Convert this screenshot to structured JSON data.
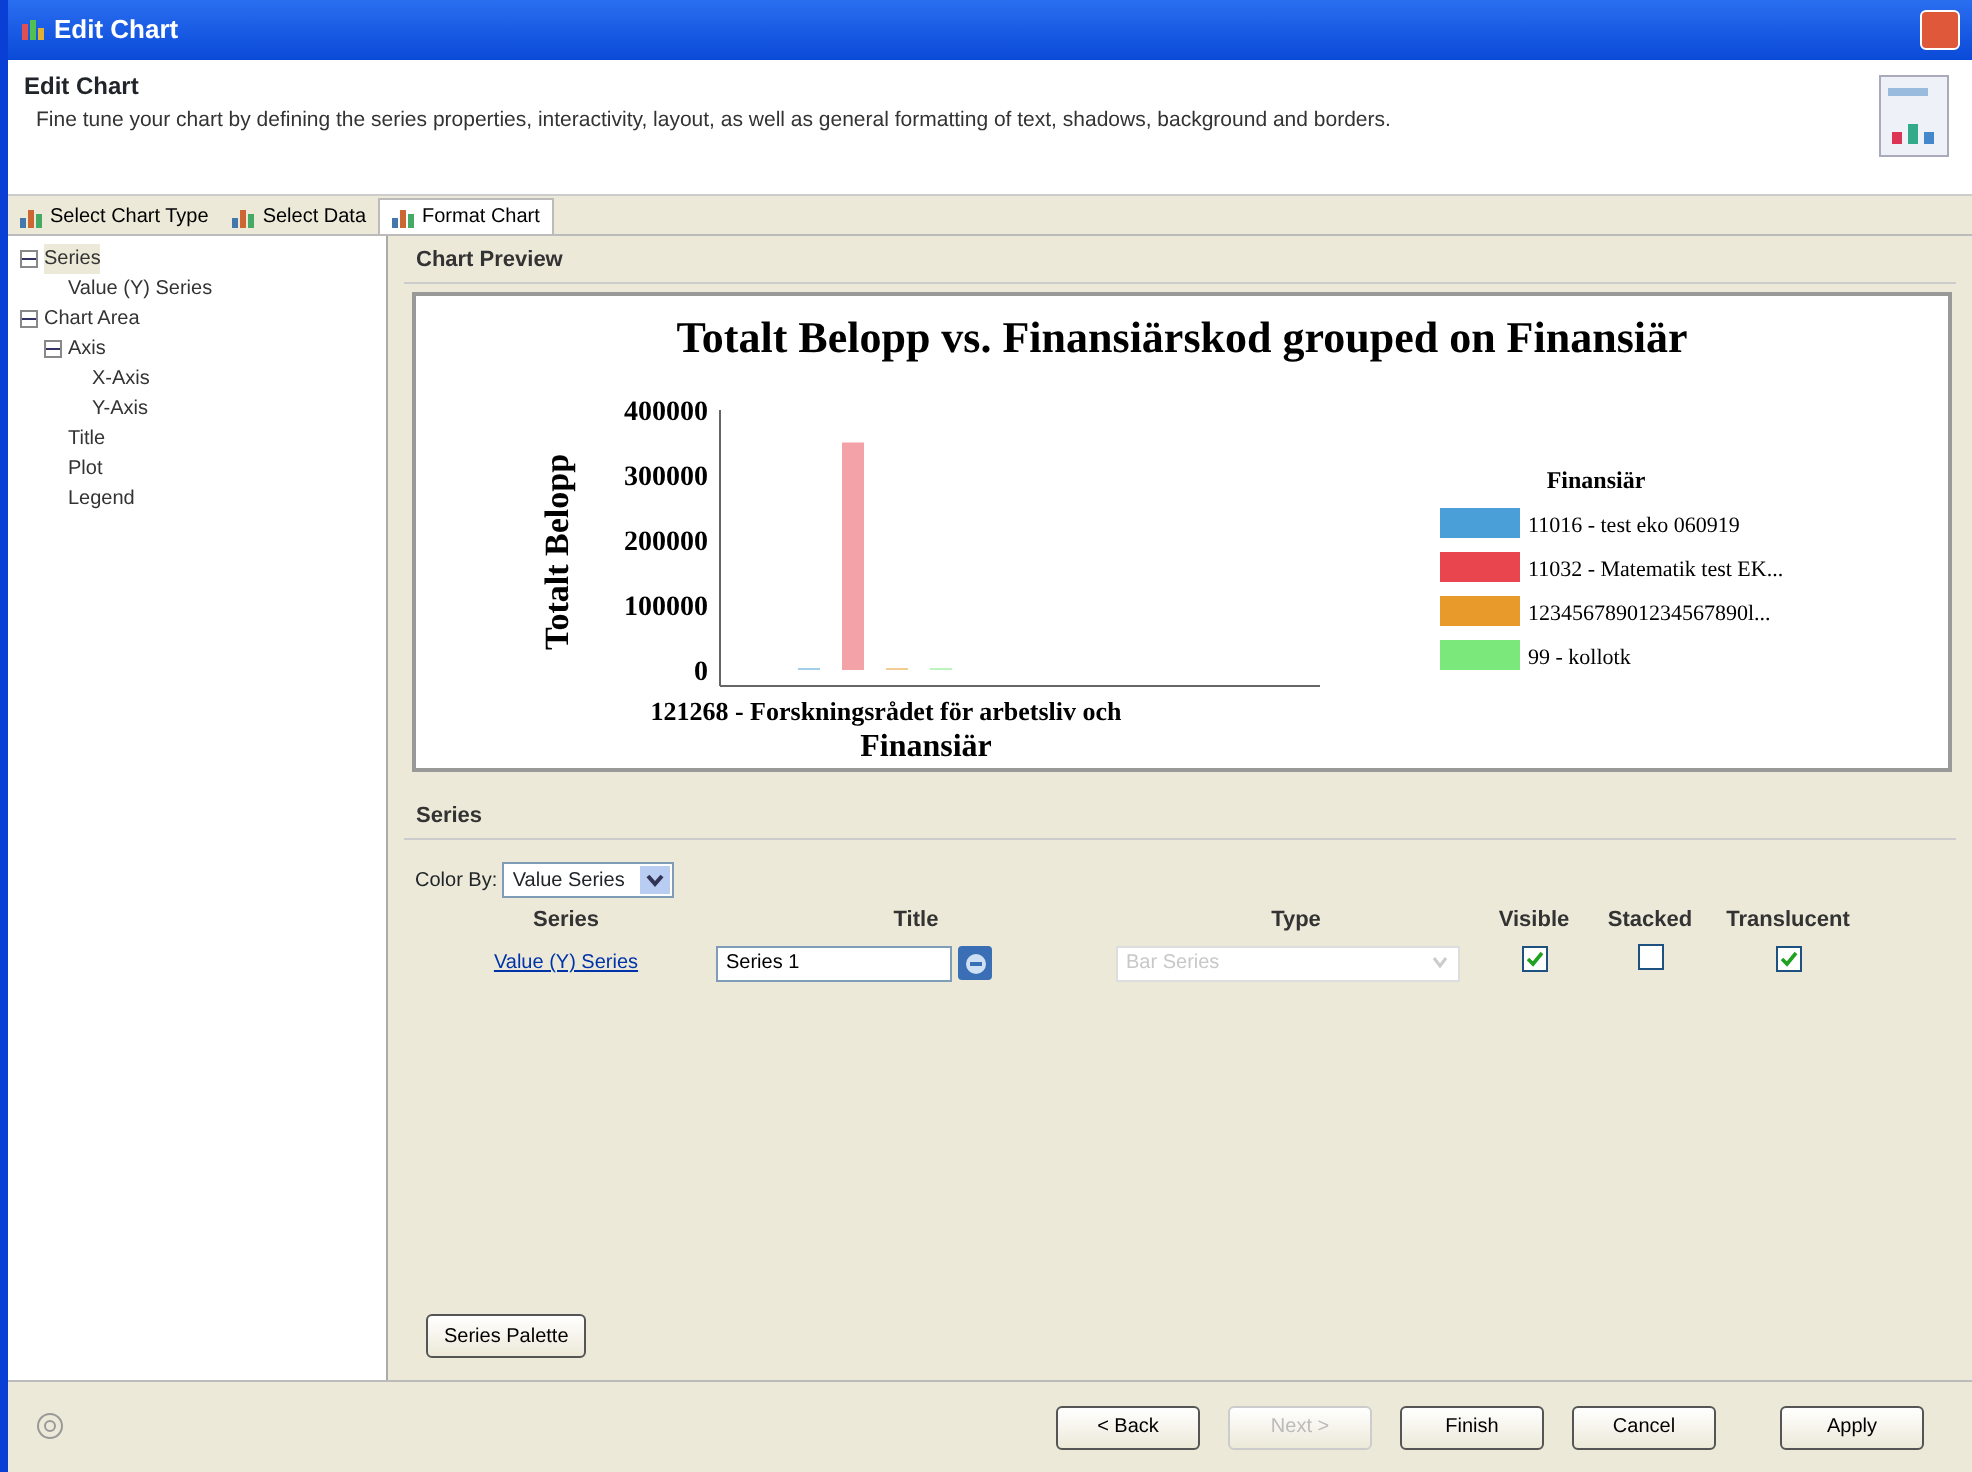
{
  "window": {
    "title": "Edit Chart"
  },
  "header": {
    "title": "Edit Chart",
    "description": "Fine tune your chart by defining the series properties, interactivity, layout, as well as general formatting of text, shadows, background and borders."
  },
  "tabs": [
    {
      "label": "Select Chart Type",
      "selected": false
    },
    {
      "label": "Select Data",
      "selected": false
    },
    {
      "label": "Format Chart",
      "selected": true
    }
  ],
  "tree": [
    {
      "label": "Series",
      "expanded": true,
      "selected": true,
      "children": [
        {
          "label": "Value (Y) Series",
          "selected": false
        }
      ]
    },
    {
      "label": "Chart Area",
      "expanded": true,
      "selected": false,
      "children": [
        {
          "label": "Axis",
          "expanded": true,
          "selected": false,
          "children": [
            {
              "label": "X-Axis",
              "selected": false
            },
            {
              "label": "Y-Axis",
              "selected": false
            }
          ]
        },
        {
          "label": "Title",
          "selected": false
        },
        {
          "label": "Plot",
          "selected": false
        },
        {
          "label": "Legend",
          "selected": false
        }
      ]
    }
  ],
  "preview": {
    "heading": "Chart Preview",
    "chart_data": {
      "type": "bar",
      "title": "Totalt Belopp vs. Finansiärskod grouped on Finansiär",
      "xlabel": "Finansiär",
      "ylabel": "Totalt Belopp",
      "categories": [
        "121268 - Forskningsrådet för arbetsliv och"
      ],
      "yticks": [
        0,
        100000,
        200000,
        300000,
        400000
      ],
      "ylim": [
        0,
        400000
      ],
      "legend": {
        "title": "Finansiär"
      },
      "series": [
        {
          "name": "11016 - test eko 060919",
          "color": "#4a9fd8",
          "values": [
            0
          ]
        },
        {
          "name": "11032 - Matematik test EK...",
          "color": "#e8454f",
          "values": [
            350000
          ]
        },
        {
          "name": "12345678901234567890l...",
          "color": "#e89a2a",
          "values": [
            0
          ]
        },
        {
          "name": "99 - kollotk",
          "color": "#7be87b",
          "values": [
            0
          ]
        }
      ]
    }
  },
  "series_section": {
    "heading": "Series",
    "color_by_label": "Color By:",
    "color_by_value": "Value Series",
    "columns": [
      "Series",
      "Title",
      "Type",
      "Visible",
      "Stacked",
      "Translucent"
    ],
    "rows": [
      {
        "series": "Value (Y) Series",
        "title": "Series 1",
        "type": "Bar Series",
        "type_disabled": true,
        "visible": true,
        "stacked": false,
        "translucent": true
      }
    ],
    "palette_button": "Series Palette"
  },
  "footer": {
    "buttons": [
      {
        "label": "< Back",
        "disabled": false
      },
      {
        "label": "Next >",
        "disabled": true
      },
      {
        "label": "Finish",
        "disabled": false
      },
      {
        "label": "Cancel",
        "disabled": false
      },
      {
        "label": "Apply",
        "disabled": false
      }
    ]
  }
}
